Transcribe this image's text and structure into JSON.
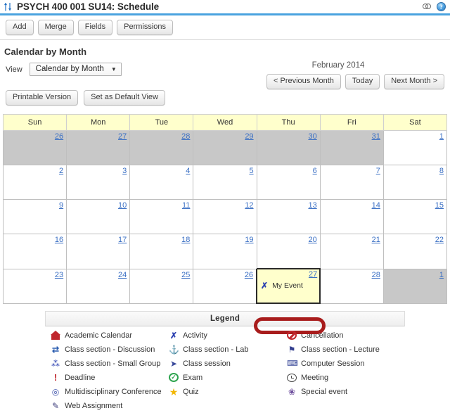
{
  "titlebar": {
    "title": "PSYCH 400 001 SU14: Schedule",
    "sync_icon": "sync-icon",
    "link_icon": "link-icon",
    "help_icon": "help-icon",
    "help_glyph": "?"
  },
  "toolbar": {
    "buttons": [
      {
        "label": "Add",
        "name": "add-button"
      },
      {
        "label": "Merge",
        "name": "merge-button"
      },
      {
        "label": "Fields",
        "name": "fields-button"
      },
      {
        "label": "Permissions",
        "name": "permissions-button"
      }
    ]
  },
  "page": {
    "section_title": "Calendar by Month",
    "view_label": "View",
    "view_selected": "Calendar by Month",
    "caret": "▼",
    "printable_label": "Printable Version",
    "default_view_label": "Set as Default View"
  },
  "month_nav": {
    "month_label": "February 2014",
    "previous_label": "< Previous Month",
    "today_label": "Today",
    "next_label": "Next Month >"
  },
  "calendar": {
    "weekdays": [
      "Sun",
      "Mon",
      "Tue",
      "Wed",
      "Thu",
      "Fri",
      "Sat"
    ],
    "weeks": [
      [
        {
          "day": "26",
          "out": true
        },
        {
          "day": "27",
          "out": true
        },
        {
          "day": "28",
          "out": true
        },
        {
          "day": "29",
          "out": true
        },
        {
          "day": "30",
          "out": true
        },
        {
          "day": "31",
          "out": true
        },
        {
          "day": "1",
          "out": false
        }
      ],
      [
        {
          "day": "2",
          "out": false
        },
        {
          "day": "3",
          "out": false
        },
        {
          "day": "4",
          "out": false
        },
        {
          "day": "5",
          "out": false
        },
        {
          "day": "6",
          "out": false
        },
        {
          "day": "7",
          "out": false
        },
        {
          "day": "8",
          "out": false
        }
      ],
      [
        {
          "day": "9",
          "out": false
        },
        {
          "day": "10",
          "out": false
        },
        {
          "day": "11",
          "out": false
        },
        {
          "day": "12",
          "out": false
        },
        {
          "day": "13",
          "out": false
        },
        {
          "day": "14",
          "out": false
        },
        {
          "day": "15",
          "out": false
        }
      ],
      [
        {
          "day": "16",
          "out": false
        },
        {
          "day": "17",
          "out": false
        },
        {
          "day": "18",
          "out": false
        },
        {
          "day": "19",
          "out": false
        },
        {
          "day": "20",
          "out": false
        },
        {
          "day": "21",
          "out": false
        },
        {
          "day": "22",
          "out": false
        }
      ],
      [
        {
          "day": "23",
          "out": false
        },
        {
          "day": "24",
          "out": false
        },
        {
          "day": "25",
          "out": false
        },
        {
          "day": "26",
          "out": false
        },
        {
          "day": "27",
          "out": false,
          "selected": true,
          "event": "My Event",
          "event_icon": "activity-icon"
        },
        {
          "day": "28",
          "out": false
        },
        {
          "day": "1",
          "out": true
        }
      ]
    ]
  },
  "annotation": {
    "color": "#a81c1c",
    "shape": "rounded-oval-highlight"
  },
  "legend": {
    "header": "Legend",
    "columns": [
      [
        {
          "label": "Academic Calendar",
          "icon": "house-icon",
          "cls": "ic-house",
          "glyph": ""
        },
        {
          "label": "Class section - Discussion",
          "icon": "arrows-icon",
          "cls": "ic-arrows",
          "glyph": "⇄"
        },
        {
          "label": "Class section - Small Group",
          "icon": "people-icon",
          "cls": "ic-people",
          "glyph": "⁂"
        },
        {
          "label": "Deadline",
          "icon": "exclamation-icon",
          "cls": "ic-excl",
          "glyph": "!"
        },
        {
          "label": "Multidisciplinary Conference",
          "icon": "globe-icon",
          "cls": "ic-globe",
          "glyph": "◎"
        },
        {
          "label": "Web Assignment",
          "icon": "notepad-icon",
          "cls": "ic-note",
          "glyph": "✎"
        }
      ],
      [
        {
          "label": "Activity",
          "icon": "activity-icon",
          "cls": "ic-runner",
          "glyph": "✗"
        },
        {
          "label": "Class section - Lab",
          "icon": "lab-icon",
          "cls": "ic-lab",
          "glyph": "⚓"
        },
        {
          "label": "Class session",
          "icon": "cursor-icon",
          "cls": "ic-cursor",
          "glyph": "➤"
        },
        {
          "label": "Exam",
          "icon": "check-circle-icon",
          "cls": "ic-exam",
          "glyph": "✓"
        },
        {
          "label": "Quiz",
          "icon": "star-icon",
          "cls": "ic-star",
          "glyph": "★"
        }
      ],
      [
        {
          "label": "Cancellation",
          "icon": "cancel-icon",
          "cls": "ic-cancel",
          "glyph": ""
        },
        {
          "label": "Class section - Lecture",
          "icon": "lecture-icon",
          "cls": "ic-lecture",
          "glyph": "⚑"
        },
        {
          "label": "Computer Session",
          "icon": "computer-icon",
          "cls": "ic-computer",
          "glyph": "⌨"
        },
        {
          "label": "Meeting",
          "icon": "clock-icon",
          "cls": "ic-clock",
          "glyph": ""
        },
        {
          "label": "Special event",
          "icon": "special-event-icon",
          "cls": "ic-special",
          "glyph": "❀"
        }
      ]
    ]
  }
}
